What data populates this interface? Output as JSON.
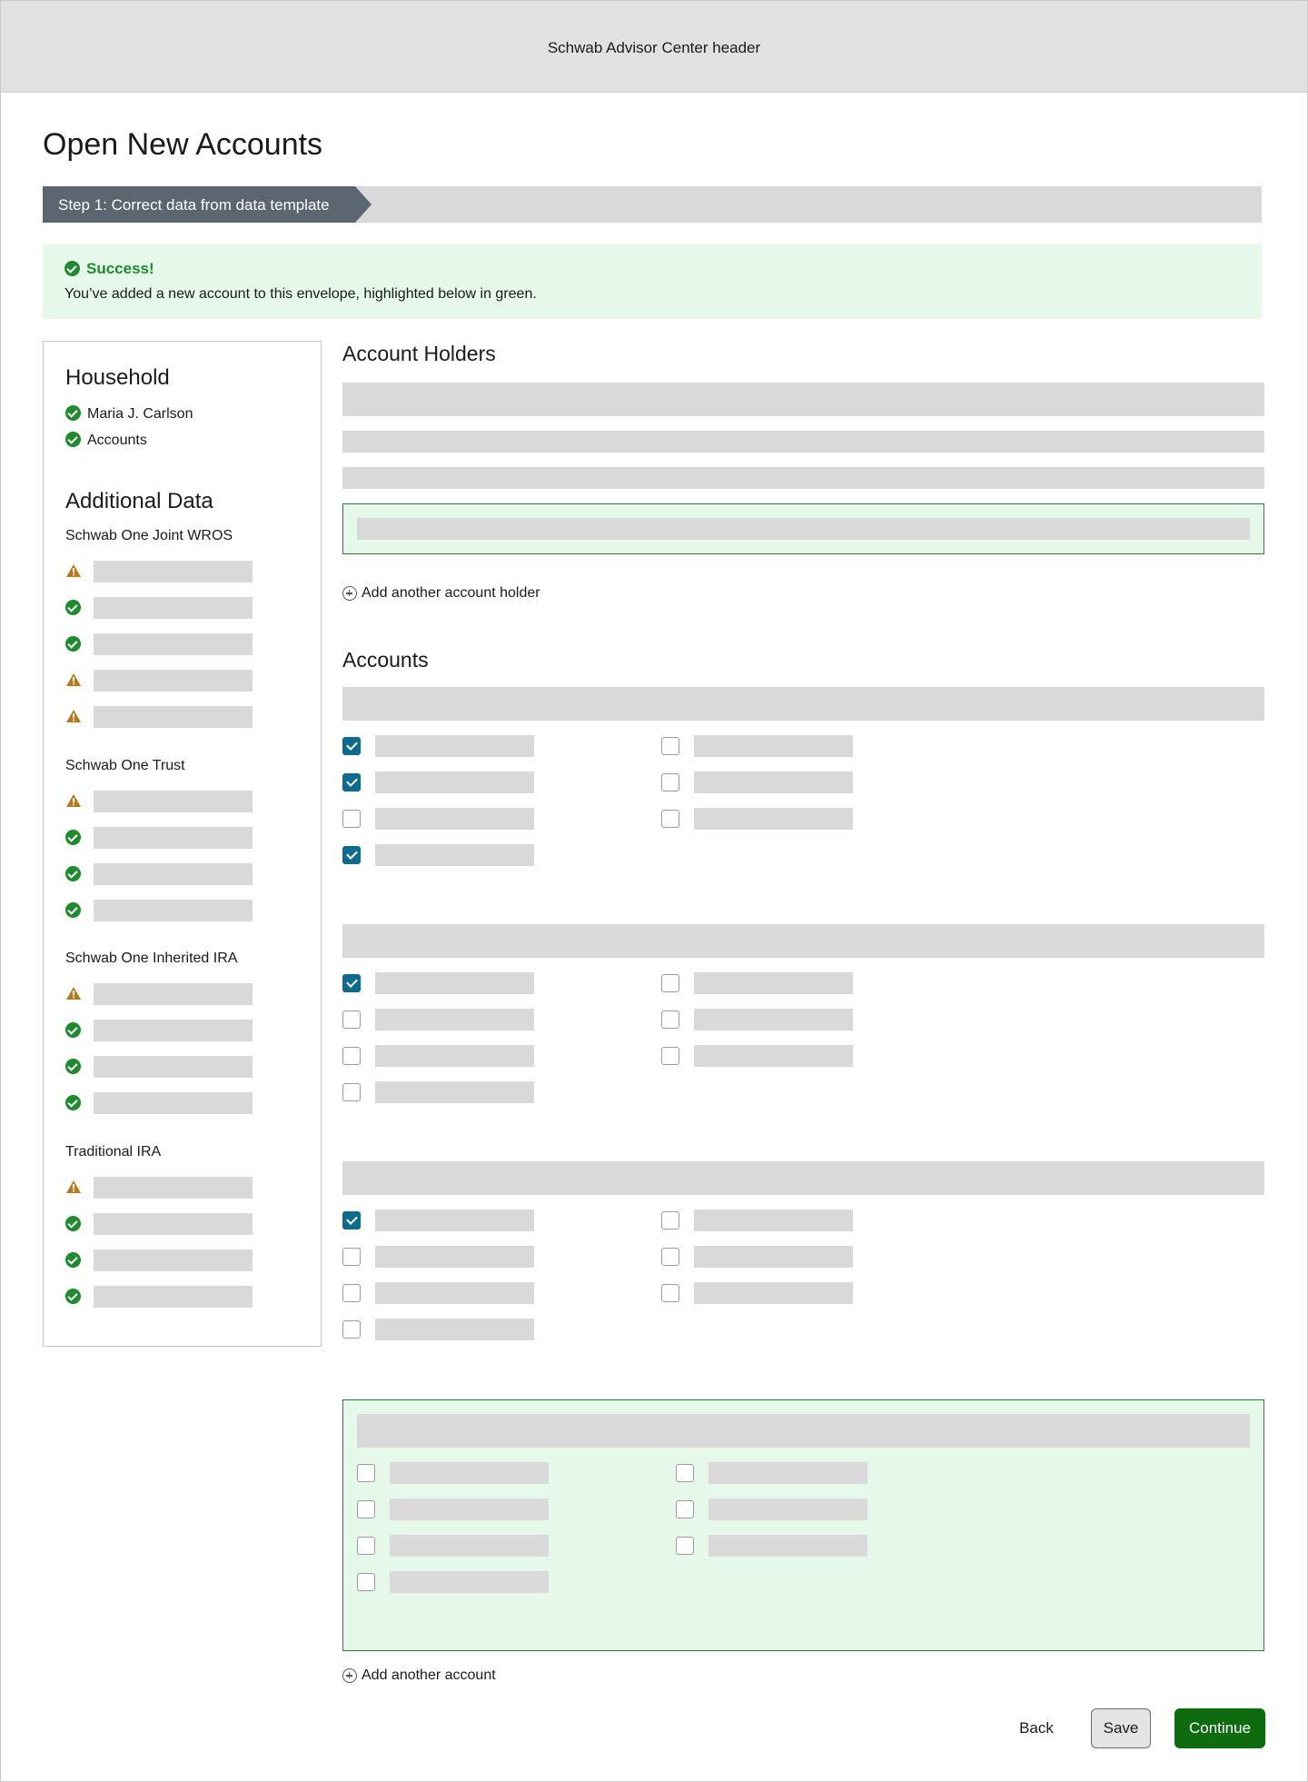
{
  "header": {
    "title": "Schwab Advisor Center header"
  },
  "page": {
    "title": "Open New Accounts"
  },
  "stepper": {
    "current_step": "Step 1: Correct data from data template"
  },
  "alert": {
    "title": "Success!",
    "message": "You’ve added a new account to this envelope, highlighted below in green.",
    "color": "#1f8a2e",
    "background": "#e6f8ea"
  },
  "sidebar": {
    "household_heading": "Household",
    "household_items": [
      {
        "label": "Maria J. Carlson",
        "status": "check-circle-icon"
      },
      {
        "label": "Accounts",
        "status": "check-circle-icon"
      }
    ],
    "additional_heading": "Additional Data",
    "groups": [
      {
        "title": "Schwab One Joint WROS",
        "statuses": [
          "warning",
          "ok",
          "ok",
          "warning",
          "warning"
        ]
      },
      {
        "title": "Schwab One Trust",
        "statuses": [
          "warning",
          "ok",
          "ok",
          "ok"
        ]
      },
      {
        "title": "Schwab One Inherited IRA",
        "statuses": [
          "warning",
          "ok",
          "ok",
          "ok"
        ]
      },
      {
        "title": "Traditional IRA",
        "statuses": [
          "warning",
          "ok",
          "ok",
          "ok"
        ]
      }
    ]
  },
  "account_holders": {
    "heading": "Account Holders",
    "add_link": "Add another account holder"
  },
  "accounts": {
    "heading": "Accounts",
    "add_link": "Add another account",
    "blocks": [
      {
        "left": [
          true,
          true,
          false,
          true
        ],
        "right": [
          false,
          false,
          false
        ],
        "highlighted": false
      },
      {
        "left": [
          true,
          false,
          false,
          false
        ],
        "right": [
          false,
          false,
          false
        ],
        "highlighted": false
      },
      {
        "left": [
          true,
          false,
          false,
          false
        ],
        "right": [
          false,
          false,
          false
        ],
        "highlighted": false
      },
      {
        "left": [
          false,
          false,
          false,
          false
        ],
        "right": [
          false,
          false,
          false
        ],
        "highlighted": true
      }
    ]
  },
  "actions": {
    "back": "Back",
    "save": "Save",
    "continue": "Continue"
  },
  "colors": {
    "primary_button": "#0e6b0e",
    "checkbox_checked": "#0f6b8e",
    "success": "#1f8a2e",
    "warning": "#b7791f",
    "placeholder": "#d9d9d9"
  }
}
